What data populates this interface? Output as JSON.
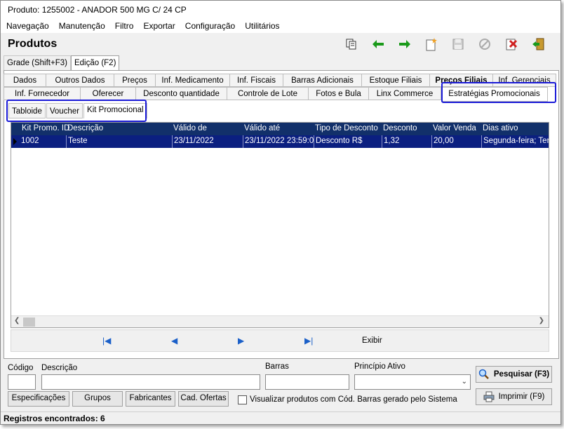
{
  "window": {
    "title": "Produto: 1255002 - ANADOR 500 MG C/ 24 CP"
  },
  "menu": [
    "Navegação",
    "Manutenção",
    "Filtro",
    "Exportar",
    "Configuração",
    "Utilitários"
  ],
  "header": {
    "title": "Produtos"
  },
  "toolbar": {
    "icons": [
      "copy-icon",
      "arrow-left-icon",
      "arrow-right-icon",
      "new-icon",
      "save-icon",
      "cancel-icon",
      "delete-icon",
      "exit-icon"
    ],
    "colors": {
      "arrow": "#1a9a1a",
      "new": "#f0a020",
      "delete": "#d02020"
    }
  },
  "mode_tabs": [
    "Grade (Shift+F3)",
    "Edição (F2)"
  ],
  "tabs_row1": [
    "Dados",
    "Outros Dados",
    "Preços",
    "Inf. Medicamento",
    "Inf. Fiscais",
    "Barras Adicionais",
    "Estoque Filiais",
    "Preços Filiais",
    "Inf. Gerenciais"
  ],
  "tabs_row2": [
    "Inf. Fornecedor",
    "Oferecer",
    "Desconto quantidade",
    "Controle de Lote",
    "Fotos e Bula",
    "Linx Commerce",
    "Estratégias Promocionais"
  ],
  "sub_tabs": [
    "Tabloide",
    "Voucher",
    "Kit Promocional"
  ],
  "grid": {
    "columns": [
      "Kit Promo. ID",
      "Descrição",
      "Válido de",
      "Válido até",
      "Tipo de Desconto",
      "Desconto",
      "Valor Venda",
      "Dias ativo"
    ],
    "rows": [
      [
        "1002",
        "Teste",
        "23/11/2022",
        "23/11/2022 23:59:00",
        "Desconto R$",
        "1,32",
        "20,00",
        "Segunda-feira; Terça-feira"
      ]
    ],
    "header_color": "#12306a",
    "selected_color": "#0b1f80"
  },
  "navigator": {
    "buttons": [
      "first-record-icon",
      "prev-record-icon",
      "next-record-icon",
      "last-record-icon"
    ],
    "exibir_label": "Exibir"
  },
  "filters": {
    "codigo_label": "Código",
    "descricao_label": "Descrição",
    "barras_label": "Barras",
    "principio_label": "Princípio Ativo",
    "search_button": "Pesquisar (F3)",
    "print_button": "Imprimir (F9)",
    "buttons": [
      "Especificações",
      "Grupos",
      "Fabricantes",
      "Cad. Ofertas"
    ],
    "checkbox_label": "Visualizar produtos com Cód. Barras gerado pelo Sistema"
  },
  "status": {
    "records": "Registros encontrados: 6"
  },
  "highlight_color": "#1a1ad8"
}
